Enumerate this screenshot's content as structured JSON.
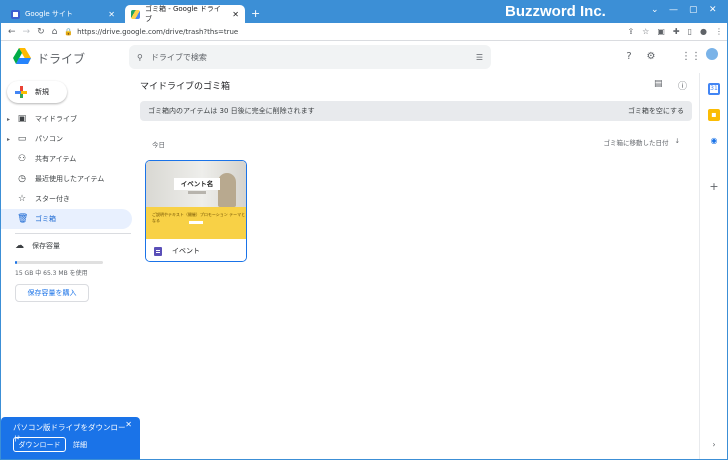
{
  "browser": {
    "tabs": [
      {
        "title": "Google サイト",
        "active": false
      },
      {
        "title": "ゴミ箱 - Google ドライブ",
        "active": true
      }
    ],
    "brand_overlay": "Buzzword Inc.",
    "url": "https://drive.google.com/drive/trash?ths=true",
    "colors": {
      "frame": "#3c8fd6"
    }
  },
  "header": {
    "logo_text": "ドライブ",
    "search_placeholder": "ドライブで検索"
  },
  "sidebar": {
    "new_label": "新規",
    "items": [
      {
        "label": "マイドライブ",
        "icon": "my-drive-icon",
        "glyph": "▣",
        "expandable": true,
        "active": false
      },
      {
        "label": "パソコン",
        "icon": "computer-icon",
        "glyph": "▭",
        "expandable": true,
        "active": false
      },
      {
        "label": "共有アイテム",
        "icon": "people-icon",
        "glyph": "⚇",
        "expandable": false,
        "active": false
      },
      {
        "label": "最近使用したアイテム",
        "icon": "clock-icon",
        "glyph": "◷",
        "expandable": false,
        "active": false
      },
      {
        "label": "スター付き",
        "icon": "star-icon",
        "glyph": "☆",
        "expandable": false,
        "active": false
      },
      {
        "label": "ゴミ箱",
        "icon": "trash-icon",
        "glyph": "🗑",
        "expandable": false,
        "active": true
      }
    ],
    "storage_label": "保存容量",
    "storage_usage": "15 GB 中 65.3 MB を使用",
    "storage_fraction": 0.004,
    "buy_storage_label": "保存容量を購入"
  },
  "main": {
    "title": "マイドライブのゴミ箱",
    "banner_text": "ゴミ箱内のアイテムは 30 日後に完全に削除されます",
    "empty_trash_label": "ゴミ箱を空にする",
    "section_label": "今日",
    "sort_label": "ゴミ箱に移動した日付",
    "file": {
      "name": "イベント",
      "thumb_title": "イベント名",
      "thumb_subtitle": "開催日時",
      "thumb_text": "ご説明やテキスト（開催）プロモーション テーマとなる"
    }
  },
  "promo": {
    "title": "パソコン版ドライブをダウンロード",
    "download_label": "ダウンロード",
    "details_label": "詳細"
  }
}
